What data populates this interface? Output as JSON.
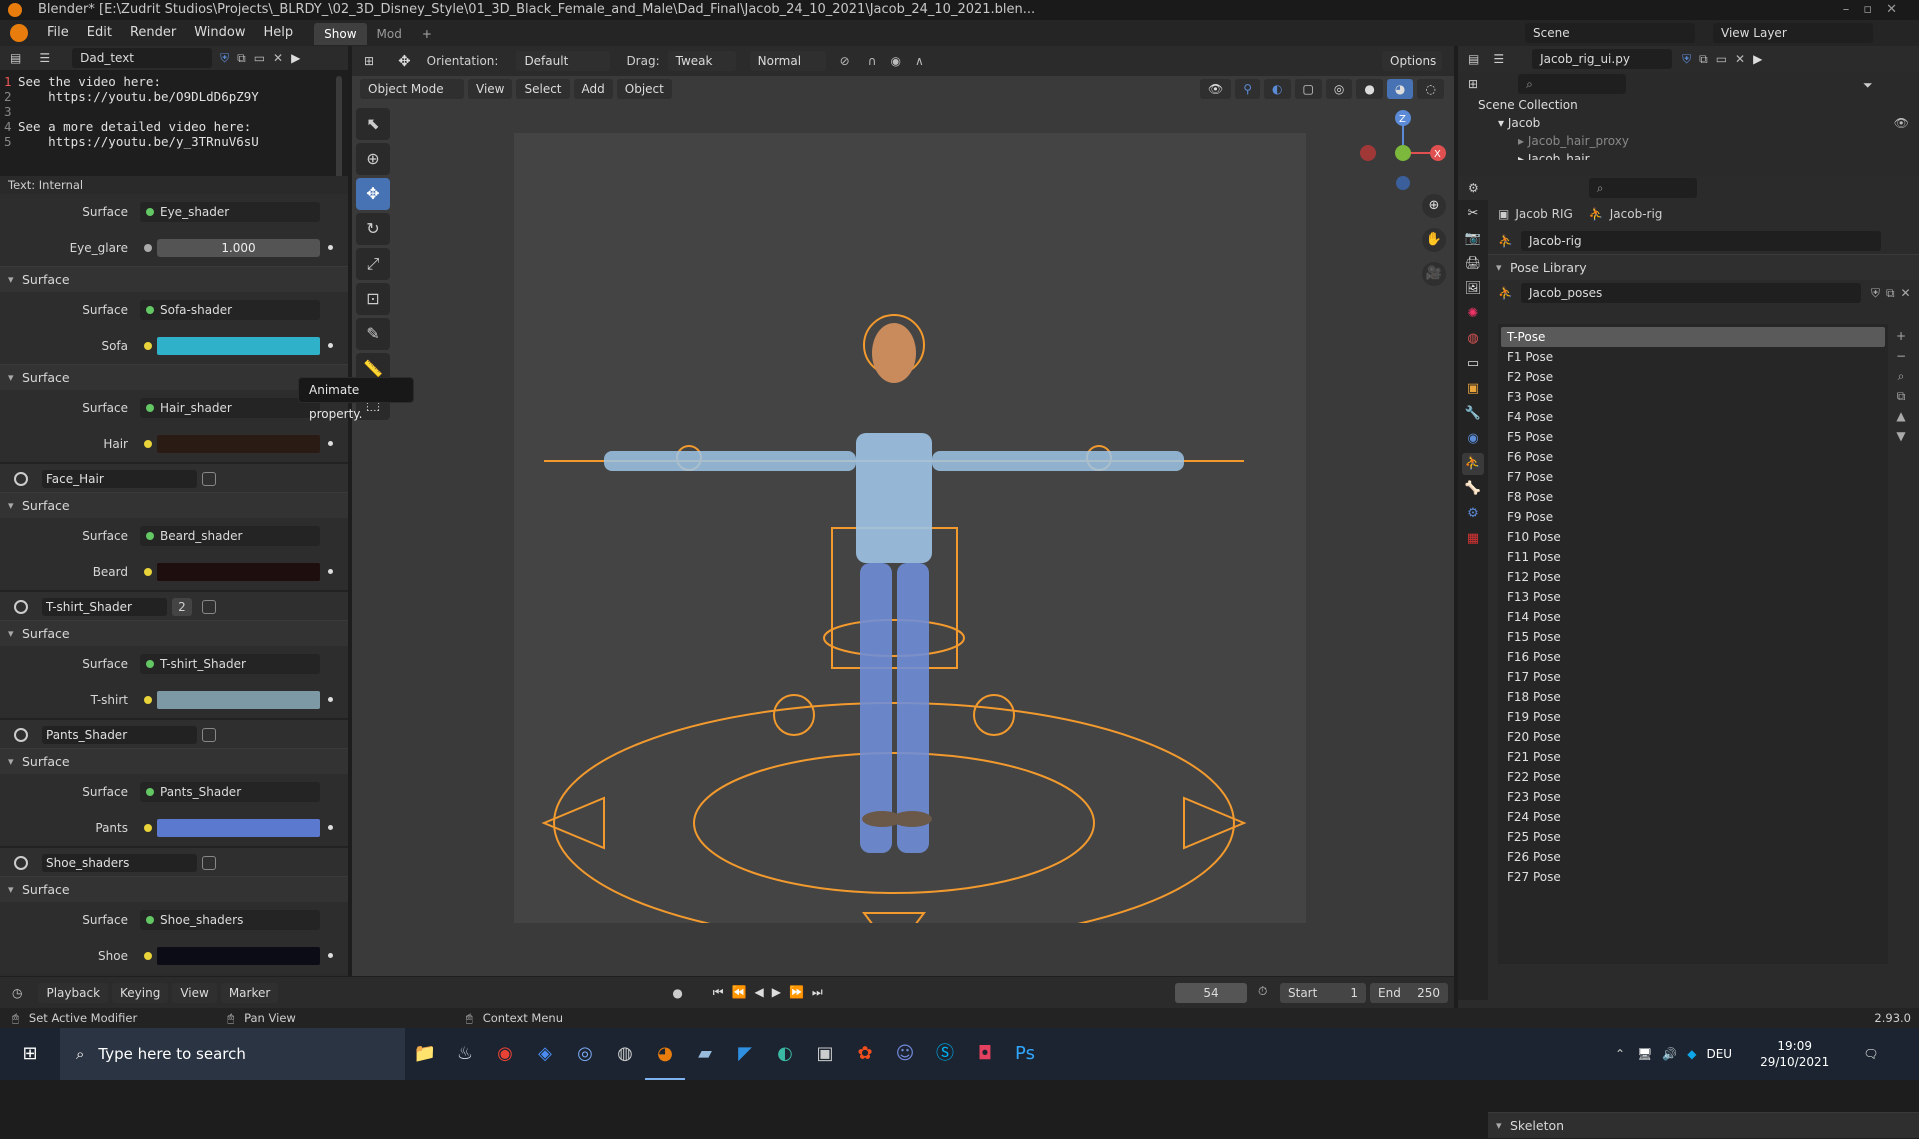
{
  "window": {
    "title": "Blender* [E:\\Zudrit Studios\\Projects\\_BLRDY_\\02_3D_Disney_Style\\01_3D_Black_Female_and_Male\\Dad_Final\\Jacob_24_10_2021\\Jacob_24_10_2021.blen..."
  },
  "menu": {
    "items": [
      "File",
      "Edit",
      "Render",
      "Window",
      "Help"
    ],
    "workspaces": [
      "Show",
      "Mod"
    ],
    "scene": "Scene",
    "view_layer": "View Layer"
  },
  "text_editor": {
    "file": "Dad_text",
    "lines": [
      {
        "n": "1",
        "t": "See the video here:"
      },
      {
        "n": "2",
        "t": "    https://youtu.be/O9DLdD6pZ9Y"
      },
      {
        "n": "3",
        "t": ""
      },
      {
        "n": "4",
        "t": "See a more detailed video here:"
      },
      {
        "n": "5",
        "t": "    https://youtu.be/y_3TRnuV6sU"
      }
    ],
    "footer": "Text: Internal"
  },
  "properties": {
    "eye": {
      "surface_label": "Surface",
      "surface": "Eye_shader",
      "glare_label": "Eye_glare",
      "glare": "1.000"
    },
    "sofa": {
      "section": "Surface",
      "surface_label": "Surface",
      "surface": "Sofa-shader",
      "color_label": "Sofa",
      "color": "#2fb1c9"
    },
    "hair": {
      "section": "Surface",
      "surface_label": "Surface",
      "surface": "Hair_shader",
      "color_label": "Hair",
      "color": "#2b1b15"
    },
    "face": {
      "material": "Face_Hair",
      "section": "Surface",
      "surface_label": "Surface",
      "surface": "Beard_shader",
      "color_label": "Beard",
      "color": "#1e0e0d"
    },
    "tshirt": {
      "material": "T-shirt_Shader",
      "users": "2",
      "section": "Surface",
      "surface_label": "Surface",
      "surface": "T-shirt_Shader",
      "color_label": "T-shirt",
      "color": "#7e99a6"
    },
    "pants": {
      "material": "Pants_Shader",
      "section": "Surface",
      "surface_label": "Surface",
      "surface": "Pants_Shader",
      "color_label": "Pants",
      "color": "#5b79cf"
    },
    "shoes": {
      "material": "Shoe_shaders",
      "section": "Surface",
      "surface_label": "Surface",
      "surface": "Shoe_shaders",
      "color_label": "Shoe",
      "color": "#0c0c16"
    }
  },
  "tooltip": "Animate property.",
  "viewport": {
    "orientation_label": "Orientation:",
    "orientation": "Default",
    "drag_label": "Drag:",
    "drag": "Tweak",
    "pivot": "Normal",
    "options": "Options",
    "mode": "Object Mode",
    "menus": [
      "View",
      "Select",
      "Add",
      "Object"
    ],
    "axes": {
      "z": "Z",
      "x": "X"
    }
  },
  "timeline": {
    "menus": [
      "Playback",
      "Keying",
      "View",
      "Marker"
    ],
    "frame": "54",
    "start_label": "Start",
    "start": "1",
    "end_label": "End",
    "end": "250"
  },
  "status": {
    "left": "Set Active Modifier",
    "mid": "Pan View",
    "right": "Context Menu",
    "version": "2.93.0"
  },
  "outliner": {
    "file": "Jacob_rig_ui.py",
    "collection": "Scene Collection",
    "items": [
      "Jacob",
      "Jacob_hair_proxy",
      "Jacob_hair"
    ]
  },
  "prop_editor": {
    "object": "Jacob RIG",
    "armature": "Jacob-rig",
    "data": "Jacob-rig",
    "panel": "Pose Library",
    "library": "Jacob_poses",
    "poses": [
      "T-Pose",
      "F1 Pose",
      "F2 Pose",
      "F3 Pose",
      "F4 Pose",
      "F5 Pose",
      "F6 Pose",
      "F7 Pose",
      "F8 Pose",
      "F9 Pose",
      "F10 Pose",
      "F11 Pose",
      "F12 Pose",
      "F13 Pose",
      "F14 Pose",
      "F15 Pose",
      "F16 Pose",
      "F17 Pose",
      "F18 Pose",
      "F19 Pose",
      "F20 Pose",
      "F21 Pose",
      "F22 Pose",
      "F23 Pose",
      "F24 Pose",
      "F25 Pose",
      "F26 Pose",
      "F27 Pose"
    ],
    "skeleton": "Skeleton"
  },
  "taskbar": {
    "search": "Type here to search",
    "lang": "DEU",
    "time": "19:09",
    "date": "29/10/2021"
  }
}
